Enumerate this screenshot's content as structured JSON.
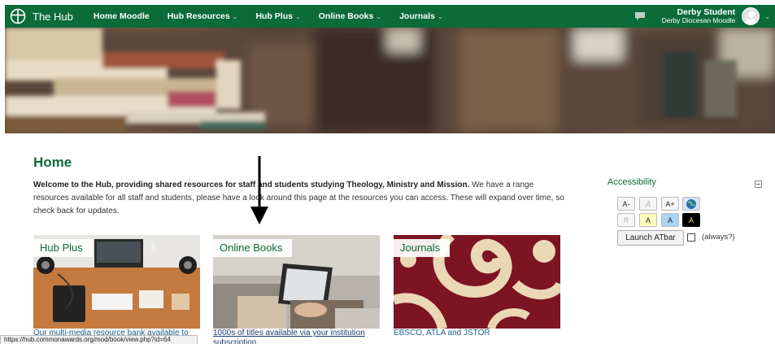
{
  "brand": {
    "name": "The Hub",
    "icon": "hub-cross-logo-icon"
  },
  "nav": {
    "items": [
      {
        "label": "Home Moodle",
        "dropdown": false
      },
      {
        "label": "Hub Resources",
        "dropdown": true
      },
      {
        "label": "Hub Plus",
        "dropdown": true
      },
      {
        "label": "Online Books",
        "dropdown": true
      },
      {
        "label": "Journals",
        "dropdown": true
      }
    ],
    "caret": "⌄",
    "messages_icon": "chat-bubble-icon"
  },
  "user": {
    "name": "Derby Student",
    "site": "Derby Diocesan Moodle",
    "avatar_icon": "user-avatar-icon"
  },
  "colors": {
    "brand_green": "#0b6b39",
    "link_blue": "#1b5f8c",
    "journals_red": "#7d1422"
  },
  "home": {
    "title": "Home",
    "intro_bold": "Welcome to the Hub, providing shared resources for staff and students studying Theology, Ministry and Mission.",
    "intro_rest": " We have a range resources available for all staff and students, please have a look around this page at the resources you can access. These will expand over time, so check back for updates."
  },
  "tiles": [
    {
      "label": "Hub Plus",
      "caption": "Our multi-media resource bank available to"
    },
    {
      "label": "Online Books",
      "caption": "1000s of titles available via your institution",
      "caption_more": "subscription"
    },
    {
      "label": "Journals",
      "caption": "EBSCO, ATLA and JSTOR"
    }
  ],
  "accessibility": {
    "title": "Accessibility",
    "buttons": [
      "A-",
      "A",
      "A+",
      "",
      "R",
      "A",
      "A",
      "A"
    ],
    "launch": "Launch ATbar",
    "always": "(always?)"
  },
  "status_url": "https://hub.commonawards.org/mod/book/view.php?id=64"
}
